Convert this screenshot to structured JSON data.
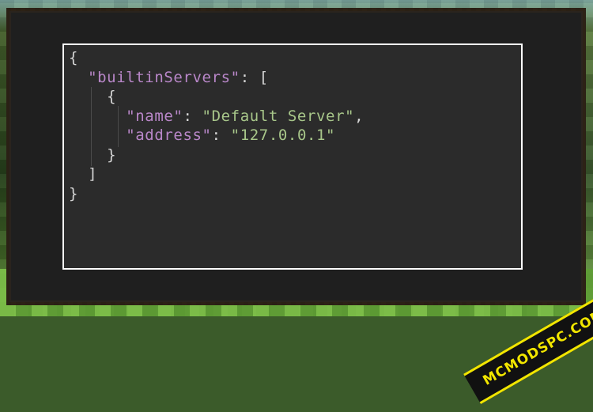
{
  "code_lines": [
    {
      "indent": 0,
      "tokens": [
        {
          "t": "{",
          "c": "punc"
        }
      ]
    },
    {
      "indent": 1,
      "tokens": [
        {
          "t": "\"builtinServers\"",
          "c": "key"
        },
        {
          "t": ": [",
          "c": "punc"
        }
      ]
    },
    {
      "indent": 2,
      "tokens": [
        {
          "t": "{",
          "c": "punc"
        }
      ]
    },
    {
      "indent": 3,
      "tokens": [
        {
          "t": "\"name\"",
          "c": "key"
        },
        {
          "t": ": ",
          "c": "punc"
        },
        {
          "t": "\"Default Server\"",
          "c": "str"
        },
        {
          "t": ",",
          "c": "punc"
        }
      ]
    },
    {
      "indent": 3,
      "tokens": [
        {
          "t": "\"address\"",
          "c": "key"
        },
        {
          "t": ": ",
          "c": "punc"
        },
        {
          "t": "\"127.0.0.1\"",
          "c": "str"
        }
      ]
    },
    {
      "indent": 2,
      "tokens": [
        {
          "t": "}",
          "c": "punc"
        }
      ]
    },
    {
      "indent": 1,
      "tokens": [
        {
          "t": "]",
          "c": "punc"
        }
      ]
    },
    {
      "indent": 0,
      "tokens": [
        {
          "t": "}",
          "c": "punc"
        }
      ]
    }
  ],
  "watermark": "MCMODSPC.COM",
  "colors": {
    "editor_bg": "#2b2b2b",
    "key": "#b987c9",
    "string": "#a8c78a",
    "punctuation": "#d6d6d6",
    "watermark": "#f2e600"
  }
}
